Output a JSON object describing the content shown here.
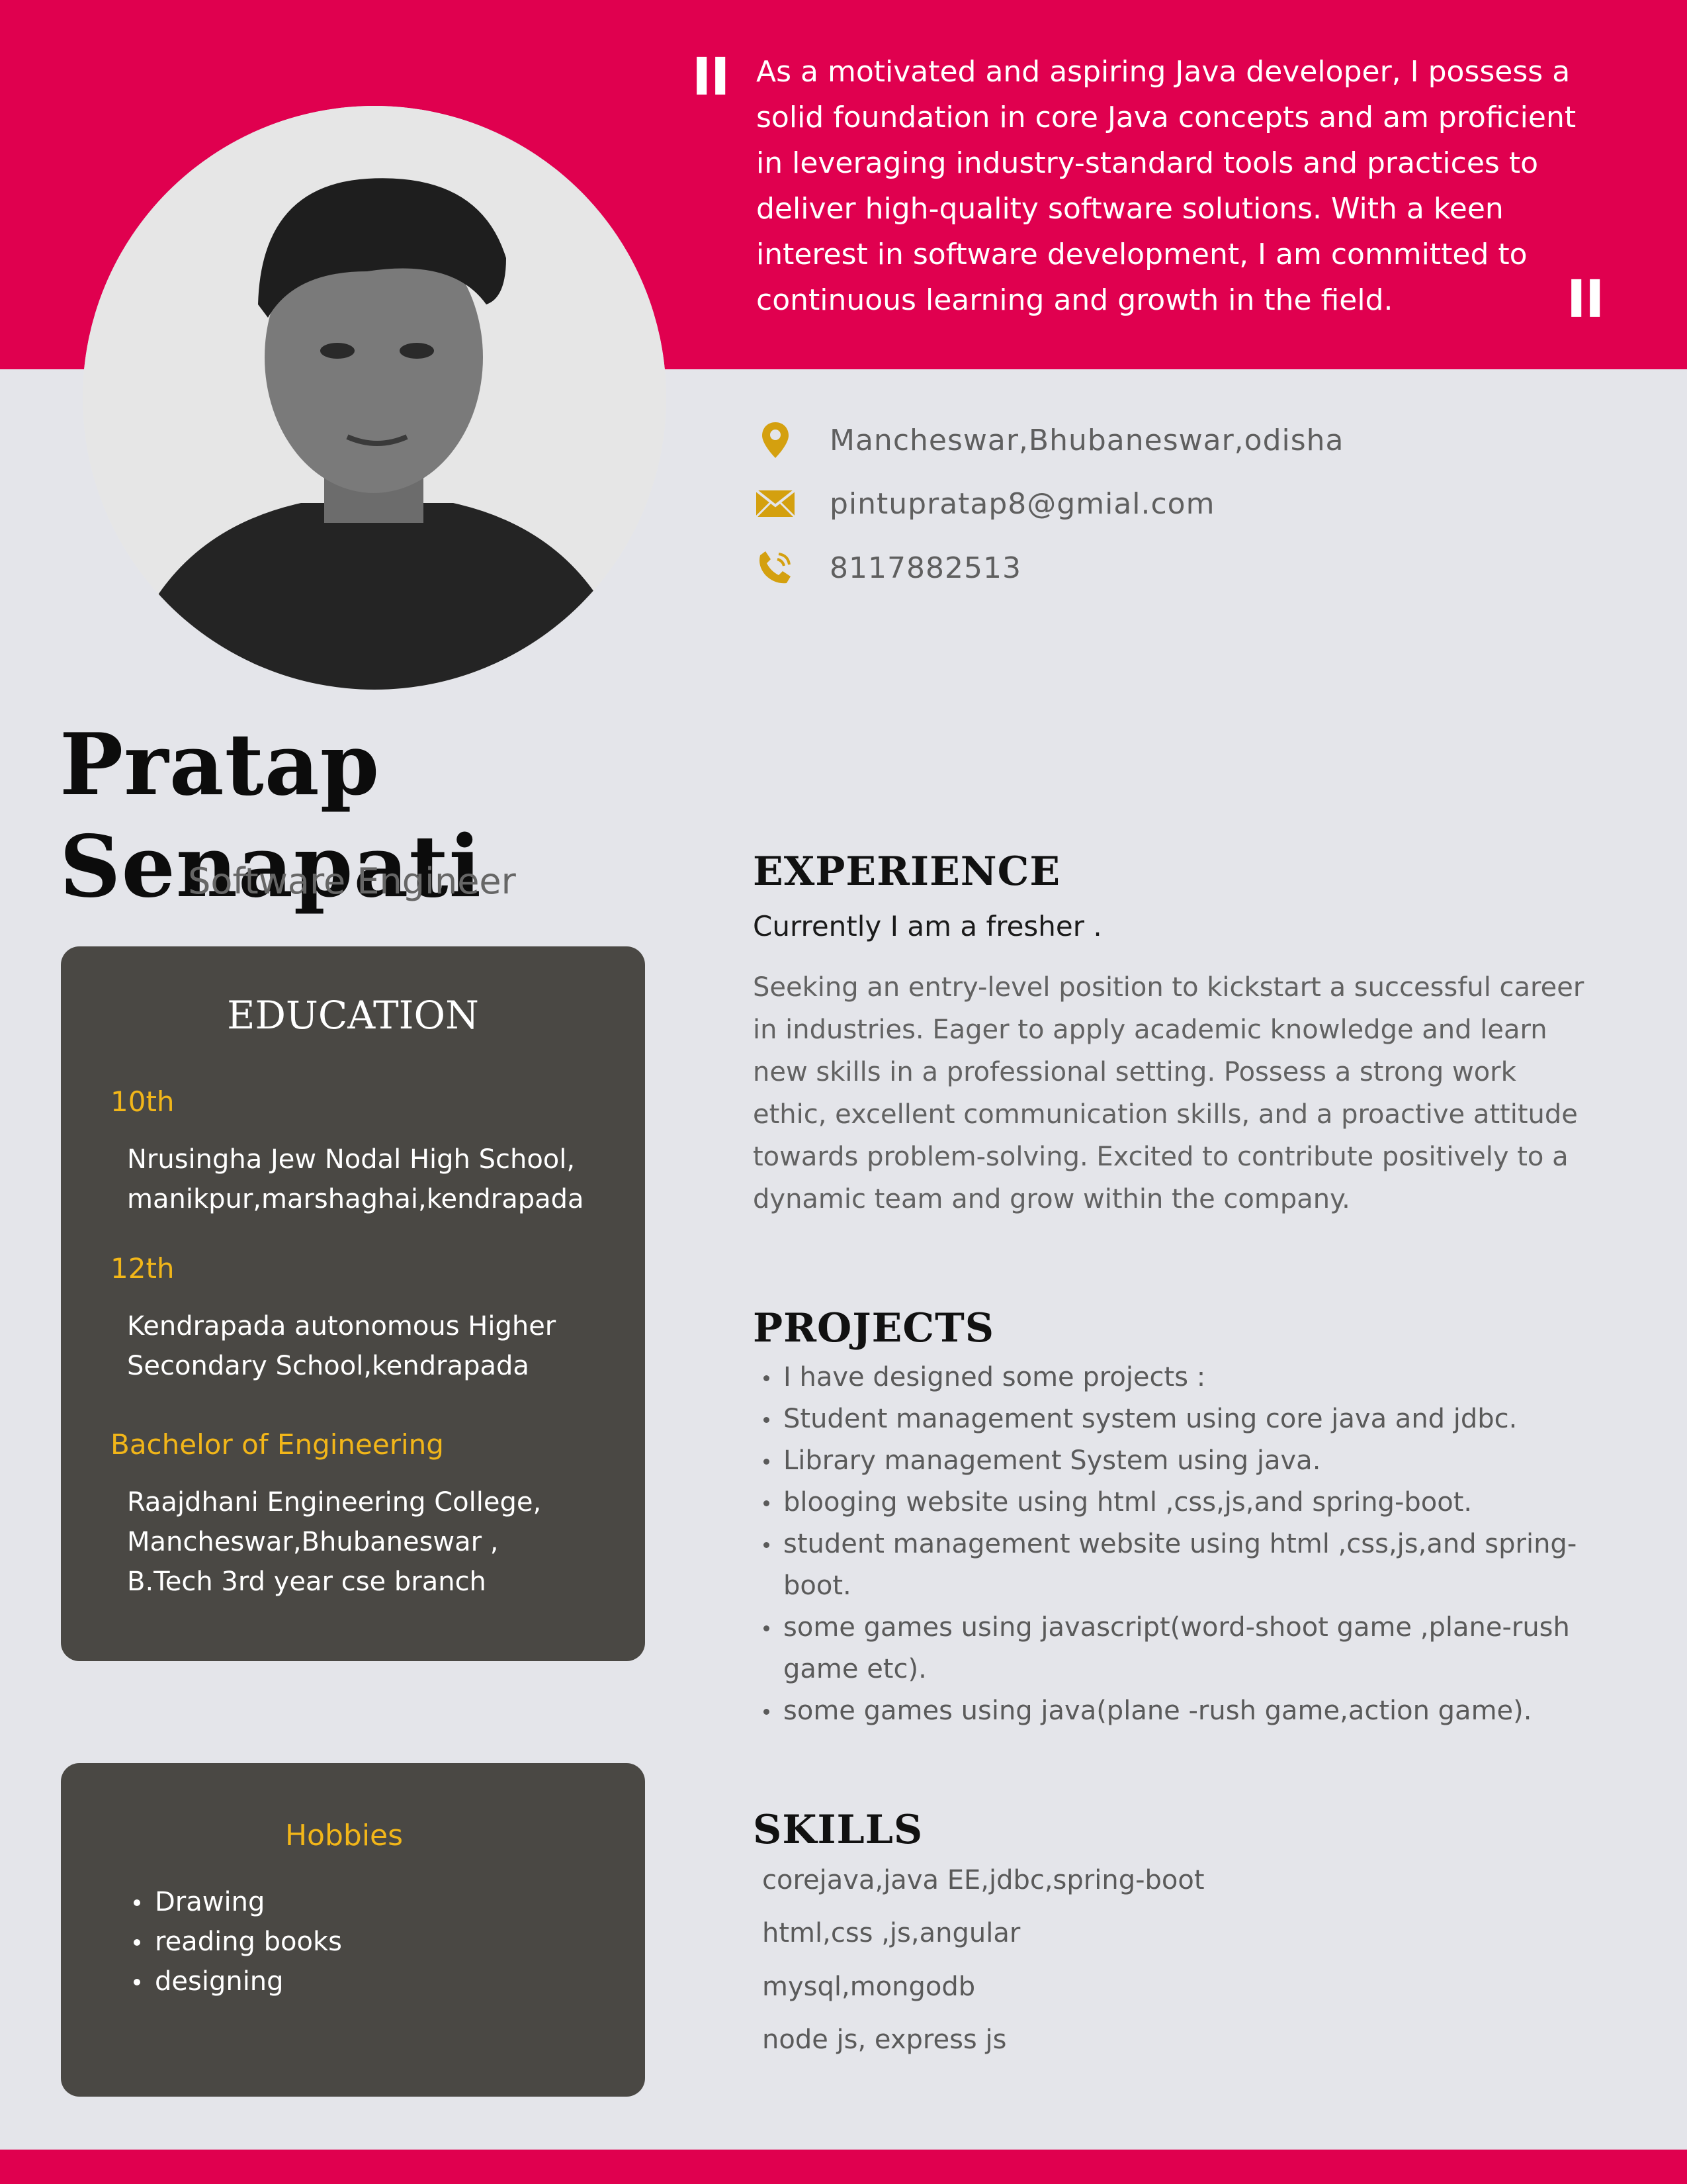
{
  "summary": {
    "text": "As a motivated and aspiring Java developer, I possess a solid foundation in core Java concepts and am proficient in leveraging industry-standard tools and practices to deliver high-quality software solutions. With a keen interest in software development, I am committed to continuous learning and growth in the field.",
    "open_quote": "\"",
    "close_quote": "\""
  },
  "contact": {
    "address": "Mancheswar,Bhubaneswar,odisha",
    "email": "pintupratap8@gmial.com",
    "phone": "8117882513",
    "address_icon": "map-pin-icon",
    "email_icon": "envelope-icon",
    "phone_icon": "phone-icon"
  },
  "profile": {
    "name": "Pratap Senapati",
    "role": "Software Engineer"
  },
  "education": {
    "title": "EDUCATION",
    "items": [
      {
        "level": "10th",
        "line1": "Nrusingha Jew Nodal High School,",
        "line2": "manikpur,marshaghai,kendrapada",
        "line3": ""
      },
      {
        "level": "12th",
        "line1": "Kendrapada autonomous Higher",
        "line2": "Secondary School,kendrapada",
        "line3": ""
      },
      {
        "level": "Bachelor of Engineering",
        "line1": "Raajdhani Engineering College,",
        "line2": "Mancheswar,Bhubaneswar ,",
        "line3": "B.Tech 3rd year cse  branch"
      }
    ]
  },
  "hobbies": {
    "title": "Hobbies",
    "items": [
      "Drawing",
      "reading books",
      "designing"
    ]
  },
  "experience": {
    "title": "EXPERIENCE",
    "subtitle": "Currently I am a fresher .",
    "body": "Seeking an entry-level position to kickstart a successful career in industries. Eager to apply academic knowledge and learn new skills in a professional setting. Possess a strong work ethic, excellent communication skills, and a proactive attitude towards problem-solving. Excited to contribute positively to a dynamic team and grow within the company."
  },
  "projects": {
    "title": "PROJECTS",
    "items": [
      "I have designed some projects :",
      " Student management system using core java and jdbc.",
      " Library management System using java.",
      " blooging website  using html ,css,js,and spring-boot.",
      " student management website  using html ,css,js,and spring-boot.",
      "some games using javascript(word-shoot game ,plane-rush game  etc).",
      "some games using java(plane -rush game,action game)."
    ]
  },
  "skills": {
    "title": "SKILLS",
    "items": [
      "corejava,java EE,jdbc,spring-boot",
      "html,css ,js,angular",
      "mysql,mongodb",
      "node js, express js"
    ]
  },
  "colors": {
    "accent": "#e0004f",
    "card": "#4a4844",
    "highlight": "#f2b619",
    "background": "#e4e5ea"
  }
}
